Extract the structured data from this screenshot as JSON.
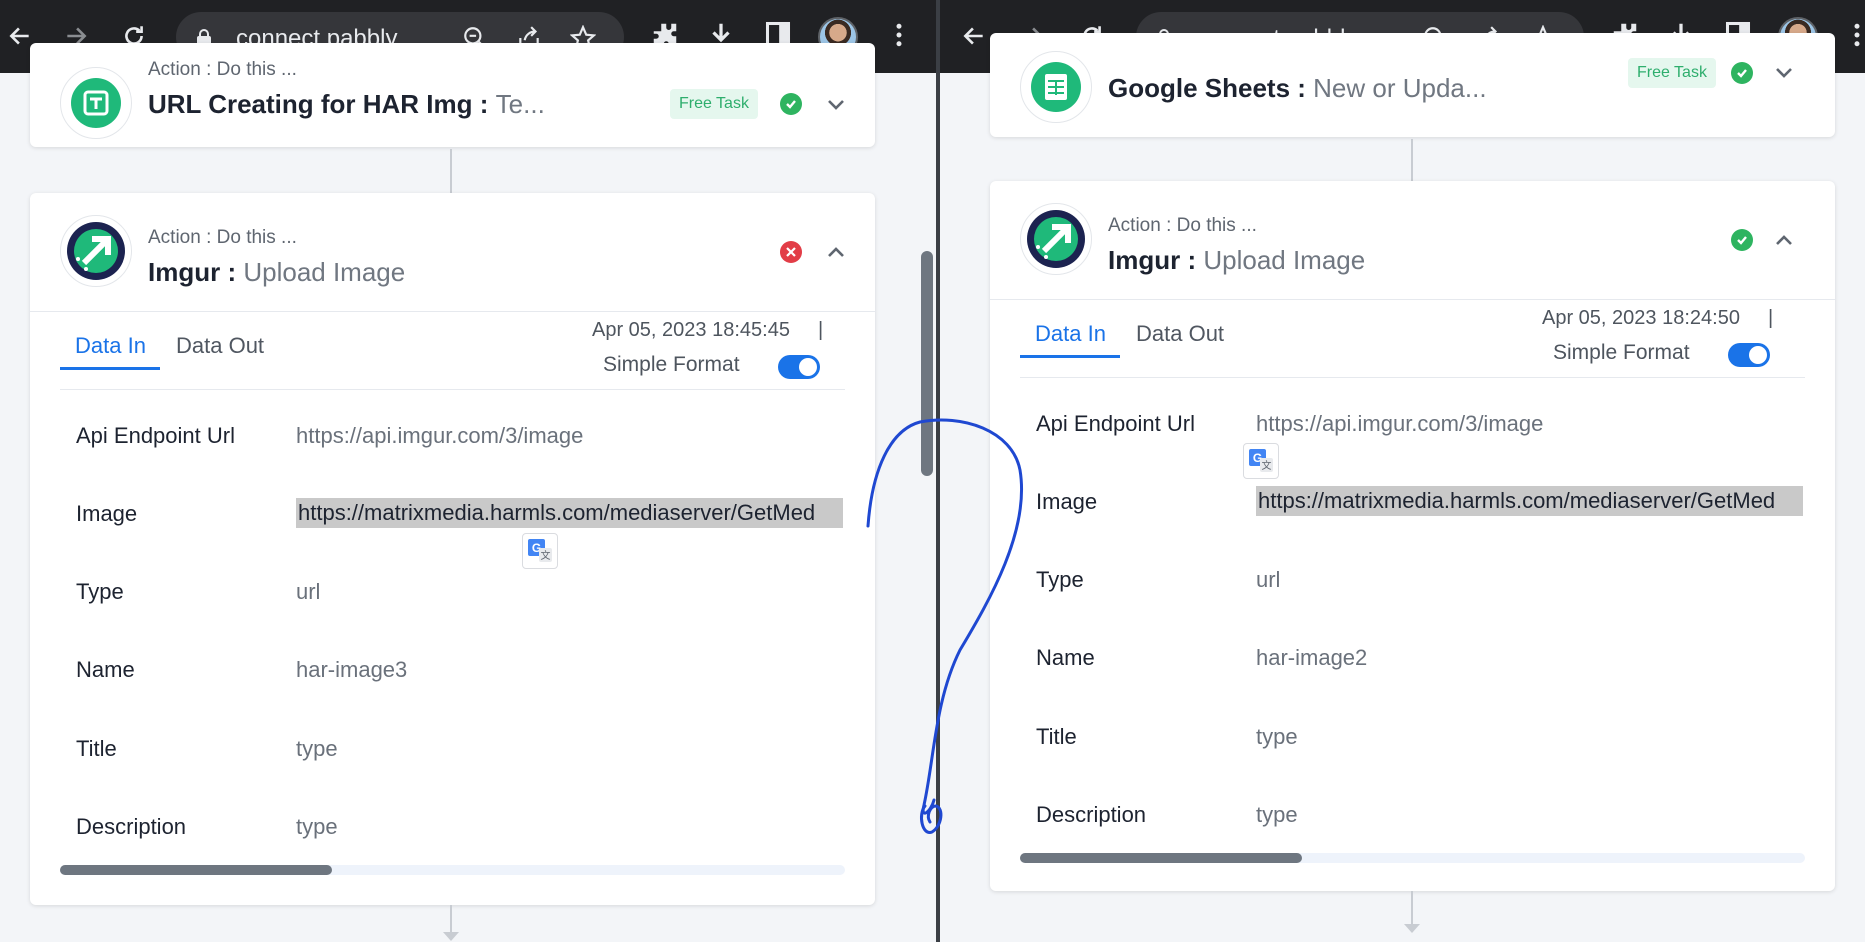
{
  "browser": {
    "left": {
      "url": "connect.pabbly...."
    },
    "right": {
      "url": "connect.pabbly...."
    }
  },
  "left": {
    "prev_step": {
      "type": "Action : Do this ...",
      "app": "URL Creating for HAR Img :",
      "event": "Te...",
      "badge": "Free Task",
      "status": "success"
    },
    "step": {
      "type": "Action : Do this ...",
      "app": "Imgur :",
      "event": "Upload Image",
      "status": "error"
    },
    "tabs": [
      "Data In",
      "Data Out"
    ],
    "timestamp": "Apr 05, 2023 18:45:45",
    "separator": "|",
    "format_label": "Simple Format",
    "fields": [
      {
        "label": "Api Endpoint Url",
        "value": "https://api.imgur.com/3/image"
      },
      {
        "label": "Image",
        "value": "https://matrixmedia.harmls.com/mediaserver/GetMed"
      },
      {
        "label": "Type",
        "value": "url"
      },
      {
        "label": "Name",
        "value": "har-image3"
      },
      {
        "label": "Title",
        "value": "type"
      },
      {
        "label": "Description",
        "value": "type"
      }
    ]
  },
  "right": {
    "prev_step": {
      "app": "Google Sheets :",
      "event": "New or Upda...",
      "badge": "Free Task",
      "status": "success"
    },
    "step": {
      "type": "Action : Do this ...",
      "app": "Imgur :",
      "event": "Upload Image",
      "status": "success"
    },
    "tabs": [
      "Data In",
      "Data Out"
    ],
    "timestamp": "Apr 05, 2023 18:24:50",
    "separator": "|",
    "format_label": "Simple Format",
    "fields": [
      {
        "label": "Api Endpoint Url",
        "value": "https://api.imgur.com/3/image"
      },
      {
        "label": "Image",
        "value": "https://matrixmedia.harmls.com/mediaserver/GetMed"
      },
      {
        "label": "Type",
        "value": "url"
      },
      {
        "label": "Name",
        "value": "har-image2"
      },
      {
        "label": "Title",
        "value": "type"
      },
      {
        "label": "Description",
        "value": "type"
      }
    ]
  },
  "colors": {
    "accent": "#1a73e8",
    "success": "#2eb460",
    "error": "#e23d47",
    "badge_bg": "#e5f7ee",
    "annotation_ink": "#1f48d1"
  },
  "icons": [
    "back-icon",
    "forward-icon",
    "reload-icon",
    "lock-icon",
    "zoom-icon",
    "share-icon",
    "star-icon",
    "extensions-icon",
    "download-icon",
    "sidepanel-icon",
    "menu-icon",
    "text-formatter-icon",
    "imgur-upload-icon",
    "google-sheets-icon",
    "google-translate-icon"
  ]
}
